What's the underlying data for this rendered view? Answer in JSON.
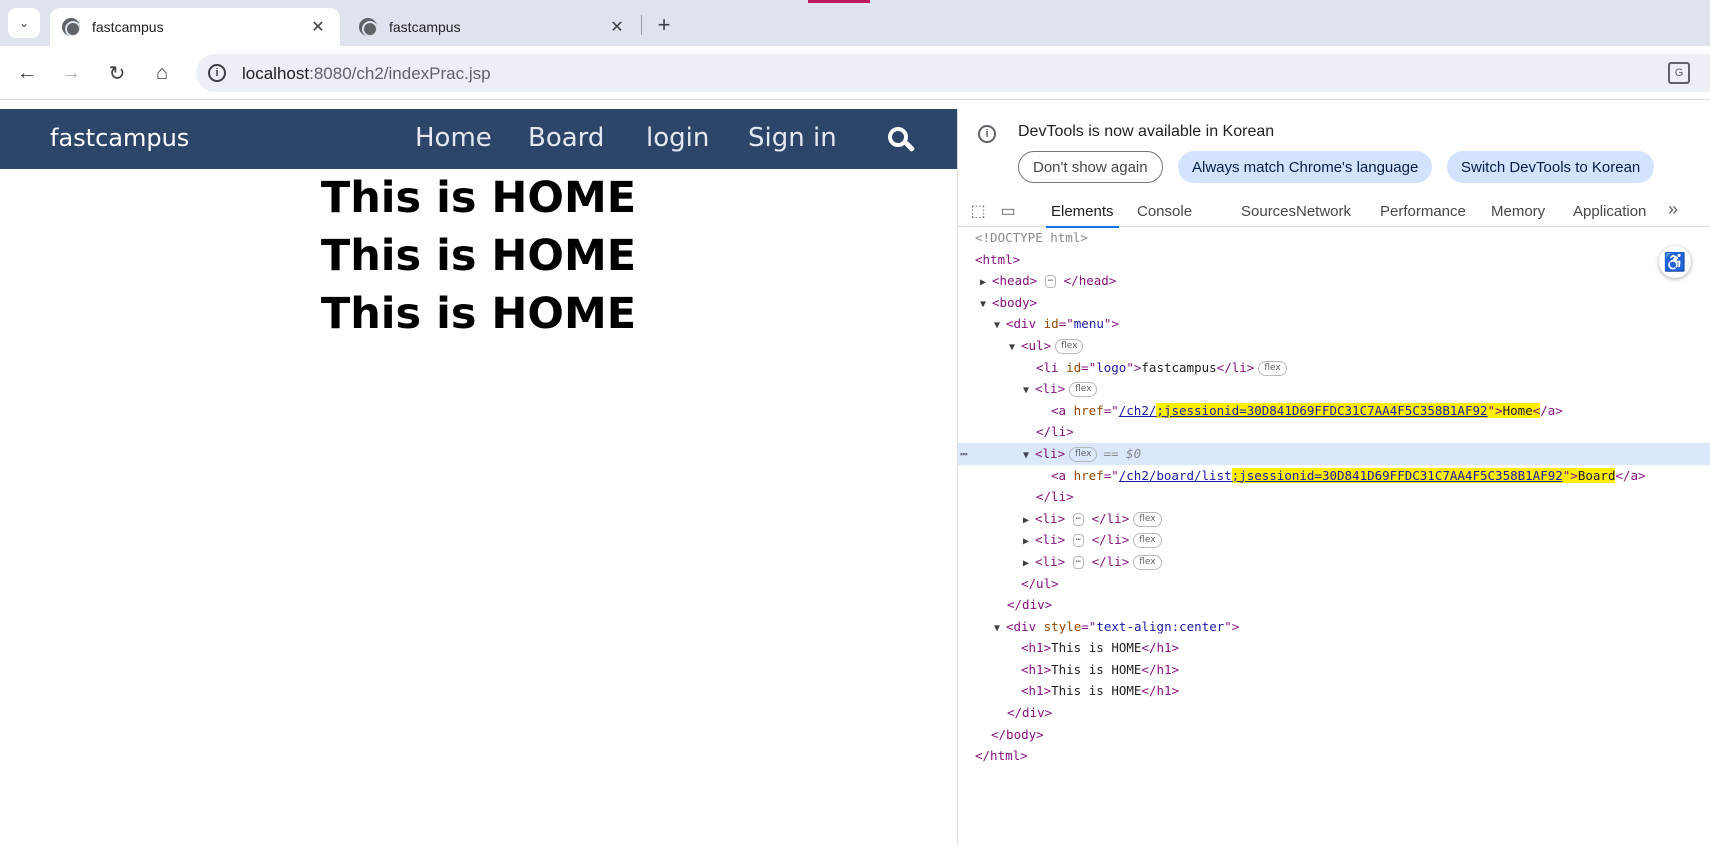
{
  "browser": {
    "tabs": [
      {
        "title": "fastcampus",
        "active": true
      },
      {
        "title": "fastcampus",
        "active": false
      }
    ],
    "url": {
      "host": "localhost",
      "rest": ":8080/ch2/indexPrac.jsp"
    }
  },
  "page": {
    "menu": {
      "logo": "fastcampus",
      "links": [
        "Home",
        "Board",
        "login",
        "Sign in"
      ]
    },
    "headings": [
      "This is HOME",
      "This is HOME",
      "This is HOME"
    ]
  },
  "devtools": {
    "notice": "DevTools is now available in Korean",
    "buttons": [
      "Don't show again",
      "Always match Chrome's language",
      "Switch DevTools to Korean"
    ],
    "tabs": [
      "Elements",
      "Console",
      "Sources",
      "Network",
      "Performance",
      "Memory",
      "Application"
    ],
    "active_tab": "Elements",
    "tree": {
      "doctype": "<!DOCTYPE html>",
      "logo_text": "fastcampus",
      "home_href_base": "/ch2/",
      "session": ";jsessionid=30D841D69FFDC31C7AA4F5C358B1AF92",
      "home_text": "Home",
      "board_href_base": "/ch2/board/list",
      "board_text": "Board",
      "style_val": "text-align:center",
      "h1_text": "This is HOME",
      "flex": "flex",
      "selected_marker": "== $0",
      "id_menu": "menu",
      "id_logo": "logo"
    }
  },
  "colors": {
    "menu_bg": "#2d4569",
    "accent": "#1a73e8",
    "highlight": "#ffee00"
  }
}
